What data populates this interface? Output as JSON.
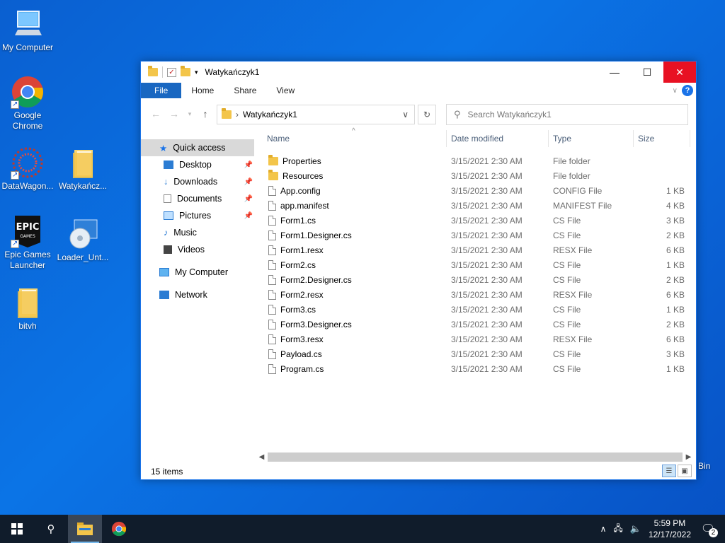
{
  "desktop": {
    "icons": [
      {
        "label": "My Computer"
      },
      {
        "label": "Google Chrome"
      },
      {
        "label": "DataWagon..."
      },
      {
        "label": "Watykańcz..."
      },
      {
        "label": "Epic Games Launcher"
      },
      {
        "label": "Loader_Unt..."
      },
      {
        "label": "bitvh"
      }
    ],
    "recycle_bin_partial_label": "Bin"
  },
  "window": {
    "title": "Watykańczyk1",
    "ribbon_tabs": [
      "File",
      "Home",
      "Share",
      "View"
    ],
    "address": "Watykańczyk1",
    "search_placeholder": "Search Watykańczyk1",
    "nav": {
      "quick_access": "Quick access",
      "items": [
        "Desktop",
        "Downloads",
        "Documents",
        "Pictures",
        "Music",
        "Videos"
      ],
      "my_computer": "My Computer",
      "network": "Network"
    },
    "columns": {
      "name": "Name",
      "date": "Date modified",
      "type": "Type",
      "size": "Size"
    },
    "files": [
      {
        "name": "Properties",
        "date": "3/15/2021 2:30 AM",
        "type": "File folder",
        "size": ""
      },
      {
        "name": "Resources",
        "date": "3/15/2021 2:30 AM",
        "type": "File folder",
        "size": ""
      },
      {
        "name": "App.config",
        "date": "3/15/2021 2:30 AM",
        "type": "CONFIG File",
        "size": "1 KB"
      },
      {
        "name": "app.manifest",
        "date": "3/15/2021 2:30 AM",
        "type": "MANIFEST File",
        "size": "4 KB"
      },
      {
        "name": "Form1.cs",
        "date": "3/15/2021 2:30 AM",
        "type": "CS File",
        "size": "3 KB"
      },
      {
        "name": "Form1.Designer.cs",
        "date": "3/15/2021 2:30 AM",
        "type": "CS File",
        "size": "2 KB"
      },
      {
        "name": "Form1.resx",
        "date": "3/15/2021 2:30 AM",
        "type": "RESX File",
        "size": "6 KB"
      },
      {
        "name": "Form2.cs",
        "date": "3/15/2021 2:30 AM",
        "type": "CS File",
        "size": "1 KB"
      },
      {
        "name": "Form2.Designer.cs",
        "date": "3/15/2021 2:30 AM",
        "type": "CS File",
        "size": "2 KB"
      },
      {
        "name": "Form2.resx",
        "date": "3/15/2021 2:30 AM",
        "type": "RESX File",
        "size": "6 KB"
      },
      {
        "name": "Form3.cs",
        "date": "3/15/2021 2:30 AM",
        "type": "CS File",
        "size": "1 KB"
      },
      {
        "name": "Form3.Designer.cs",
        "date": "3/15/2021 2:30 AM",
        "type": "CS File",
        "size": "2 KB"
      },
      {
        "name": "Form3.resx",
        "date": "3/15/2021 2:30 AM",
        "type": "RESX File",
        "size": "6 KB"
      },
      {
        "name": "Payload.cs",
        "date": "3/15/2021 2:30 AM",
        "type": "CS File",
        "size": "3 KB"
      },
      {
        "name": "Program.cs",
        "date": "3/15/2021 2:30 AM",
        "type": "CS File",
        "size": "1 KB"
      }
    ],
    "status": "15 items"
  },
  "taskbar": {
    "time": "5:59 PM",
    "date": "12/17/2022",
    "notification_count": "2"
  },
  "colors": {
    "accent": "#1967c1",
    "close": "#e81123",
    "taskbar": "#101c2b"
  }
}
